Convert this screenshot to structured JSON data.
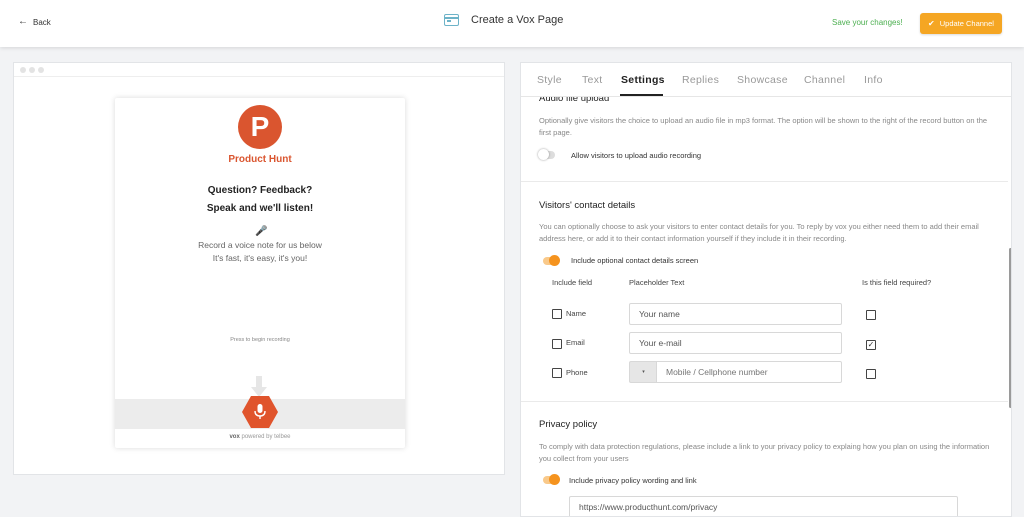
{
  "header": {
    "back_label": "Back",
    "title": "Create a Vox Page",
    "save_message": "Save your changes!",
    "update_button": "Update Channel",
    "colors": {
      "accent": "#f5a623",
      "save": "#4caf50"
    }
  },
  "preview": {
    "brand_initial": "P",
    "brand_name": "Product Hunt",
    "headline_1": "Question? Feedback?",
    "headline_2": "Speak and we'll listen!",
    "subtitle_1": "Record a voice note for us below",
    "subtitle_2": "It's fast, it's easy, it's you!",
    "press_hint": "Press to begin recording",
    "powered_brand": "vox",
    "powered_by": " powered by telbee",
    "colors": {
      "brand": "#da552f"
    }
  },
  "tabs": [
    "Style",
    "Text",
    "Settings",
    "Replies",
    "Showcase",
    "Channel",
    "Info"
  ],
  "active_tab": "Settings",
  "audio_upload": {
    "title": "Audio file upload",
    "description": "Optionally give visitors the choice to upload an audio file in mp3 format. The option will be shown to the right of the record button on the first page.",
    "toggle_label": "Allow visitors to upload audio recording",
    "enabled": false
  },
  "contact": {
    "title": "Visitors' contact details",
    "description": "You can optionally choose to ask your visitors to enter contact details for you. To reply by vox you either need them to add their email address here, or add it to their contact information yourself if they include it in their recording.",
    "toggle_label": "Include optional contact details screen",
    "enabled": true,
    "col_include": "Include field",
    "col_placeholder": "Placeholder Text",
    "col_required": "Is this field required?",
    "rows": [
      {
        "label": "Name",
        "placeholder": "Your name",
        "included": false,
        "required": false
      },
      {
        "label": "Email",
        "placeholder": "Your e-mail",
        "included": false,
        "required": true
      },
      {
        "label": "Phone",
        "placeholder": "Mobile / Cellphone number",
        "included": false,
        "required": false
      }
    ],
    "phone_select_arrow": "▾"
  },
  "privacy": {
    "title": "Privacy policy",
    "description": "To comply with data protection regulations, please include a link to your privacy policy to explaing how you plan on using the information you collect from your users",
    "toggle_label": "Include privacy policy wording and link",
    "enabled": true,
    "url": "https://www.producthunt.com/privacy"
  }
}
